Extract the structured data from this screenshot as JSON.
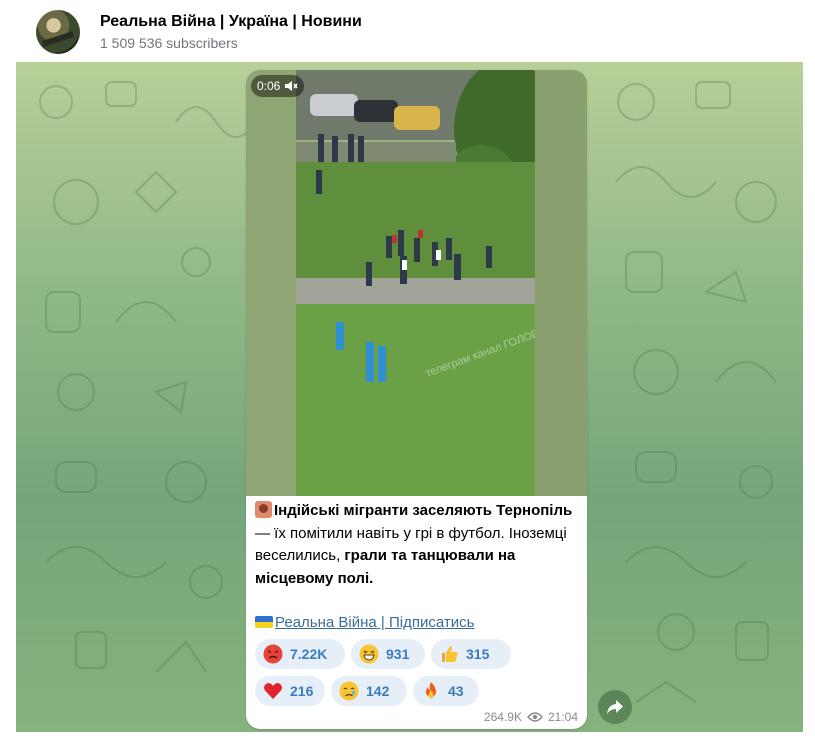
{
  "header": {
    "title": "Реальна Війна | Україна | Новини",
    "subscribers": "1 509 536 subscribers"
  },
  "message": {
    "video": {
      "duration": "0:06",
      "watermark": "телеграм канал ГОЛОВНЕ",
      "icon": "muted-speaker-icon"
    },
    "caption": {
      "part1_bold": "Індійські мігранти заселяють Тернопіль",
      "part2": " — їх помітили навіть у грі в футбол. Іноземці веселились, ",
      "part3_bold": "грали та танцювали на місцевому полі."
    },
    "links": {
      "channel": "Реальна Війна",
      "subscribe": " | Підписатись"
    },
    "reactions": [
      {
        "emoji": "angry-face-icon",
        "count": "7.22K"
      },
      {
        "emoji": "grinning-face-icon",
        "count": "931"
      },
      {
        "emoji": "thumbs-up-icon",
        "count": "315"
      },
      {
        "emoji": "red-heart-icon",
        "count": "216"
      },
      {
        "emoji": "crying-face-icon",
        "count": "142"
      },
      {
        "emoji": "fire-icon",
        "count": "43"
      }
    ],
    "views": "264.9K",
    "time": "21:04"
  },
  "colors": {
    "accent": "#3a7bbf",
    "link": "#3a6d99",
    "reaction_bg": "#e6eff8"
  }
}
